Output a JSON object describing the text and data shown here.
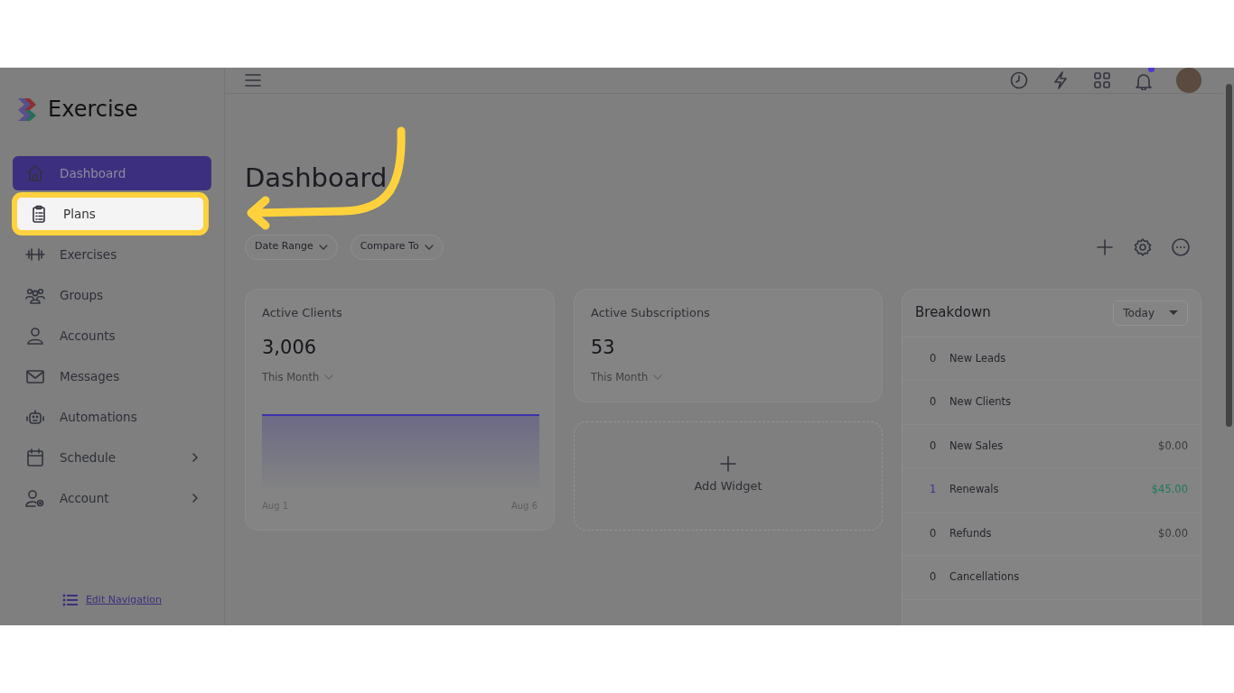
{
  "app": {
    "name": "Exercise"
  },
  "sidebar": {
    "items": [
      {
        "label": "Dashboard",
        "selected": true,
        "highlighted": false,
        "has_submenu": false
      },
      {
        "label": "Plans",
        "selected": false,
        "highlighted": true,
        "has_submenu": false
      },
      {
        "label": "Exercises",
        "selected": false,
        "highlighted": false,
        "has_submenu": false
      },
      {
        "label": "Groups",
        "selected": false,
        "highlighted": false,
        "has_submenu": false
      },
      {
        "label": "Accounts",
        "selected": false,
        "highlighted": false,
        "has_submenu": false
      },
      {
        "label": "Messages",
        "selected": false,
        "highlighted": false,
        "has_submenu": false
      },
      {
        "label": "Automations",
        "selected": false,
        "highlighted": false,
        "has_submenu": false
      },
      {
        "label": "Schedule",
        "selected": false,
        "highlighted": false,
        "has_submenu": true
      },
      {
        "label": "Account",
        "selected": false,
        "highlighted": false,
        "has_submenu": true
      }
    ],
    "footer_link": "Edit Navigation"
  },
  "topbar": {
    "notification_dot": true
  },
  "page": {
    "title": "Dashboard",
    "filters": [
      "Date Range",
      "Compare To"
    ]
  },
  "widgets": [
    {
      "title": "Active Clients",
      "value": "3,006",
      "period": "This Month",
      "chart_labels": [
        "Aug 1",
        "Aug 6"
      ]
    },
    {
      "title": "Active Subscriptions",
      "value": "53",
      "period": "This Month"
    }
  ],
  "add_widget": {
    "label": "Add Widget"
  },
  "breakdown": {
    "title": "Breakdown",
    "range": "Today",
    "rows": [
      {
        "count": "0",
        "label": "New Leads",
        "positive": false
      },
      {
        "count": "0",
        "label": "New Clients",
        "positive": false
      },
      {
        "count": "0",
        "label": "New Sales",
        "amount": "$0.00",
        "positive": false
      },
      {
        "count": "1",
        "label": "Renewals",
        "amount": "$45.00",
        "positive": true
      },
      {
        "count": "0",
        "label": "Refunds",
        "amount": "$0.00",
        "positive": false
      },
      {
        "count": "0",
        "label": "Cancellations",
        "positive": false
      }
    ]
  }
}
